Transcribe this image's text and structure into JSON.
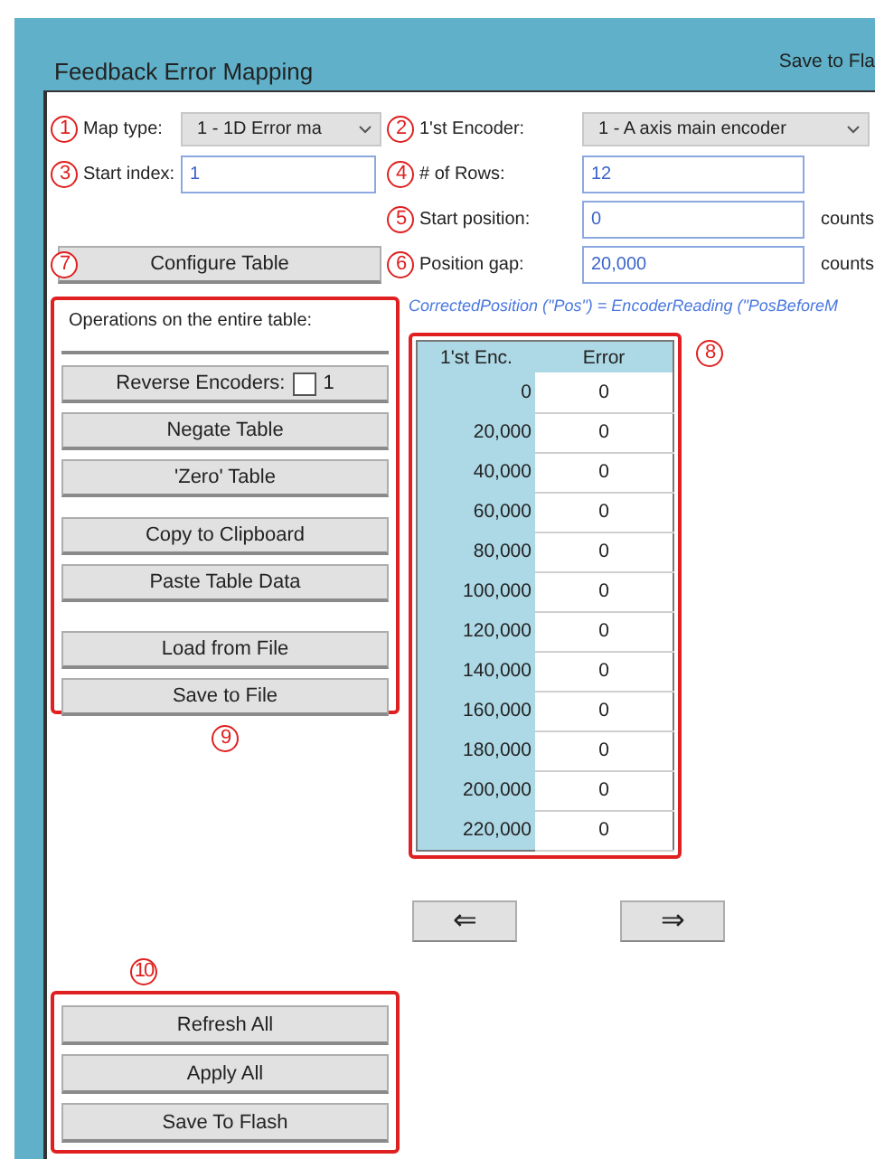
{
  "window": {
    "title": "Feedback Error Mapping",
    "header_action": "Save to Fla"
  },
  "left_fields": [
    {
      "marker": "1",
      "label": "Map type:",
      "kind": "select",
      "value": "1 - 1D Error ma"
    },
    {
      "marker": "3",
      "label": "Start index:",
      "kind": "input",
      "value": "1"
    }
  ],
  "configure": {
    "marker": "7",
    "label": "Configure Table"
  },
  "right_fields": [
    {
      "marker": "2",
      "label": "1'st Encoder:",
      "kind": "select",
      "value": "1 - A axis main encoder"
    },
    {
      "marker": "4",
      "label": "# of Rows:",
      "kind": "input",
      "value": "12"
    },
    {
      "marker": "5",
      "label": "Start position:",
      "kind": "input",
      "value": "0",
      "unit": "counts"
    },
    {
      "marker": "6",
      "label": "Position gap:",
      "kind": "input",
      "value": "20,000",
      "unit": "counts"
    }
  ],
  "operations": {
    "marker": "9",
    "heading": "Operations on the entire table:",
    "groups": [
      [
        {
          "kind": "checkbox",
          "label": "Reverse Encoders:",
          "checked": false,
          "suffix": "1"
        },
        {
          "kind": "button",
          "label": "Negate Table"
        },
        {
          "kind": "button",
          "label": "'Zero' Table"
        }
      ],
      [
        {
          "kind": "button",
          "label": "Copy to Clipboard"
        },
        {
          "kind": "button",
          "label": "Paste Table Data"
        }
      ],
      [
        {
          "kind": "button",
          "label": "Load from File"
        },
        {
          "kind": "button",
          "label": "Save to File"
        }
      ]
    ]
  },
  "formula": "CorrectedPosition (\"Pos\") = EncoderReading (\"PosBeforeM",
  "table": {
    "marker": "8",
    "columns": [
      "1'st Enc.",
      "Error"
    ],
    "rows": [
      [
        "0",
        "0"
      ],
      [
        "20,000",
        "0"
      ],
      [
        "40,000",
        "0"
      ],
      [
        "60,000",
        "0"
      ],
      [
        "80,000",
        "0"
      ],
      [
        "100,000",
        "0"
      ],
      [
        "120,000",
        "0"
      ],
      [
        "140,000",
        "0"
      ],
      [
        "160,000",
        "0"
      ],
      [
        "180,000",
        "0"
      ],
      [
        "200,000",
        "0"
      ],
      [
        "220,000",
        "0"
      ]
    ]
  },
  "nav_buttons": [
    "⇐",
    "⇒"
  ],
  "actions": {
    "marker": "10",
    "buttons": [
      "Refresh All",
      "Apply All",
      "Save To Flash"
    ]
  }
}
